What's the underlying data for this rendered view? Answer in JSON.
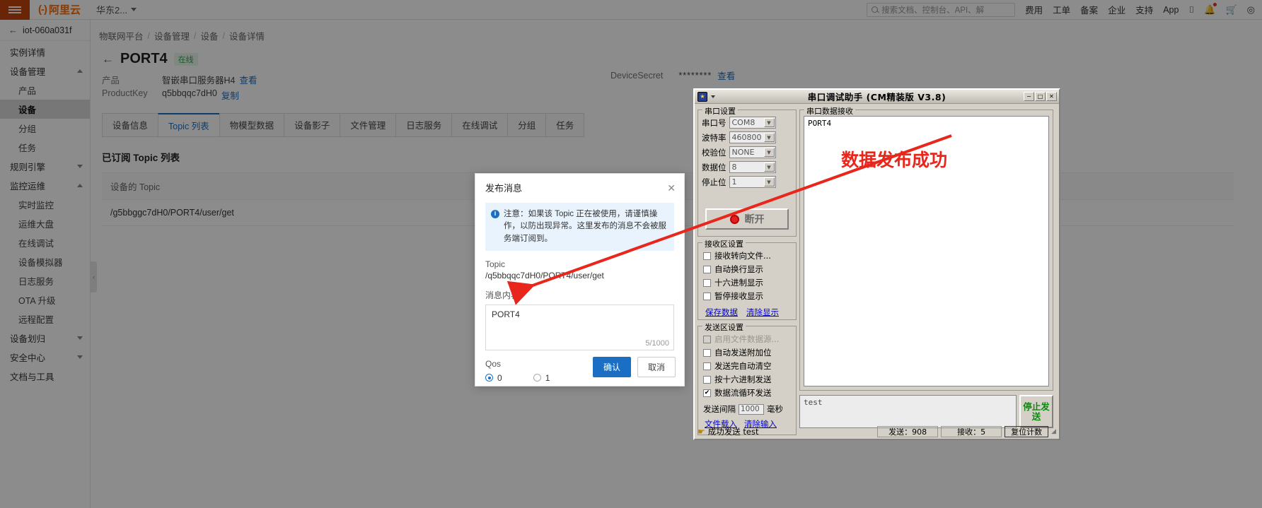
{
  "topbar": {
    "menu_icon": "hamburger-icon",
    "brand_mark": "(-)",
    "brand_name": "阿里云",
    "region": "华东2...",
    "search_placeholder": "搜索文档、控制台、API、解",
    "links": [
      "费用",
      "工单",
      "备案",
      "企业",
      "支持",
      "App"
    ],
    "icons": [
      "terminal-icon",
      "bell-icon",
      "cart-icon",
      "user-icon"
    ]
  },
  "sidebar": {
    "instance_id": "iot-060a031f",
    "back_arrow": "←",
    "items": [
      {
        "label": "实例详情",
        "level": "top",
        "chevron": ""
      },
      {
        "label": "设备管理",
        "level": "top",
        "chevron": "up"
      },
      {
        "label": "产品",
        "level": "sub",
        "chevron": ""
      },
      {
        "label": "设备",
        "level": "sub",
        "chevron": "",
        "active": true
      },
      {
        "label": "分组",
        "level": "sub",
        "chevron": ""
      },
      {
        "label": "任务",
        "level": "sub",
        "chevron": ""
      },
      {
        "label": "规则引擎",
        "level": "top",
        "chevron": "down"
      },
      {
        "label": "监控运维",
        "level": "top",
        "chevron": "up"
      },
      {
        "label": "实时监控",
        "level": "sub",
        "chevron": ""
      },
      {
        "label": "运维大盘",
        "level": "sub",
        "chevron": ""
      },
      {
        "label": "在线调试",
        "level": "sub",
        "chevron": ""
      },
      {
        "label": "设备模拟器",
        "level": "sub",
        "chevron": ""
      },
      {
        "label": "日志服务",
        "level": "sub",
        "chevron": ""
      },
      {
        "label": "OTA 升级",
        "level": "sub",
        "chevron": ""
      },
      {
        "label": "远程配置",
        "level": "sub",
        "chevron": ""
      },
      {
        "label": "设备划归",
        "level": "top",
        "chevron": "down"
      },
      {
        "label": "安全中心",
        "level": "top",
        "chevron": "down"
      },
      {
        "label": "文档与工具",
        "level": "top",
        "chevron": ""
      }
    ]
  },
  "breadcrumb": [
    "物联网平台",
    "设备管理",
    "设备",
    "设备详情"
  ],
  "page": {
    "title": "PORT4",
    "status": "在线",
    "product_key_label": "产品",
    "product_value": "智嵌串口服务器H4",
    "product_link": "查看",
    "pk_label": "ProductKey",
    "pk_value": "q5bbqqc7dH0",
    "pk_link": "复制",
    "device_secret_label": "DeviceSecret",
    "device_secret_value": "********",
    "device_secret_link": "查看"
  },
  "tabs": [
    {
      "label": "设备信息",
      "active": false
    },
    {
      "label": "Topic 列表",
      "active": true
    },
    {
      "label": "物模型数据",
      "active": false
    },
    {
      "label": "设备影子",
      "active": false
    },
    {
      "label": "文件管理",
      "active": false
    },
    {
      "label": "日志服务",
      "active": false
    },
    {
      "label": "在线调试",
      "active": false
    },
    {
      "label": "分组",
      "active": false
    },
    {
      "label": "任务",
      "active": false
    }
  ],
  "topic_section": {
    "title": "已订阅 Topic 列表",
    "column_header": "设备的 Topic",
    "rows": [
      "/g5bbggc7dH0/PORT4/user/get"
    ]
  },
  "dialog": {
    "title": "发布消息",
    "close_icon": "close-icon",
    "notice_icon": "info-icon",
    "notice": "注意：如果该 Topic 正在被使用，请谨慎操作，以防出现异常。这里发布的消息不会被服务端订阅到。",
    "topic_label": "Topic",
    "topic_value": "/q5bbqqc7dH0/PORT4/user/get",
    "message_label": "消息内容",
    "message_value": "PORT4",
    "counter": "5/1000",
    "qos_label": "Qos",
    "qos_options": [
      {
        "label": "0",
        "selected": true
      },
      {
        "label": "1",
        "selected": false
      }
    ],
    "confirm": "确认",
    "cancel": "取消"
  },
  "serial": {
    "title": "串口调试助手 (CM精装版 V3.8)",
    "window_buttons": [
      "−",
      "□",
      "✕"
    ],
    "settings_group": "串口设置",
    "settings": [
      {
        "label": "串口号",
        "value": "COM8"
      },
      {
        "label": "波特率",
        "value": "460800"
      },
      {
        "label": "校验位",
        "value": "NONE"
      },
      {
        "label": "数据位",
        "value": "8"
      },
      {
        "label": "停止位",
        "value": "1"
      }
    ],
    "connect_button": "断开",
    "recv_group": "接收区设置",
    "recv_options": [
      {
        "label": "接收转向文件...",
        "checked": false
      },
      {
        "label": "自动换行显示",
        "checked": false
      },
      {
        "label": "十六进制显示",
        "checked": false
      },
      {
        "label": "暂停接收显示",
        "checked": false
      }
    ],
    "recv_links": [
      "保存数据",
      "清除显示"
    ],
    "send_group": "发送区设置",
    "send_options": [
      {
        "label": "启用文件数据源...",
        "checked": false,
        "disabled": true
      },
      {
        "label": "自动发送附加位",
        "checked": false
      },
      {
        "label": "发送完自动清空",
        "checked": false
      },
      {
        "label": "按十六进制发送",
        "checked": false
      },
      {
        "label": "数据流循环发送",
        "checked": true
      }
    ],
    "interval_label": "发送间隔",
    "interval_value": "1000",
    "interval_unit": "毫秒",
    "send_links": [
      "文件载入",
      "清除输入"
    ],
    "recv_panel_title": "串口数据接收",
    "recv_panel_text": "PORT4",
    "send_input_text": "test",
    "stop_send_button": "停止发送",
    "status_text": "成功发送 test",
    "status_icon": "hand-pointer-icon",
    "sent_count": "发送：908",
    "recv_count": "接收：5",
    "reset_button": "复位计数"
  },
  "annotation": {
    "text": "数据发布成功",
    "color": "#e8261c",
    "arrow": "red-arrow"
  }
}
